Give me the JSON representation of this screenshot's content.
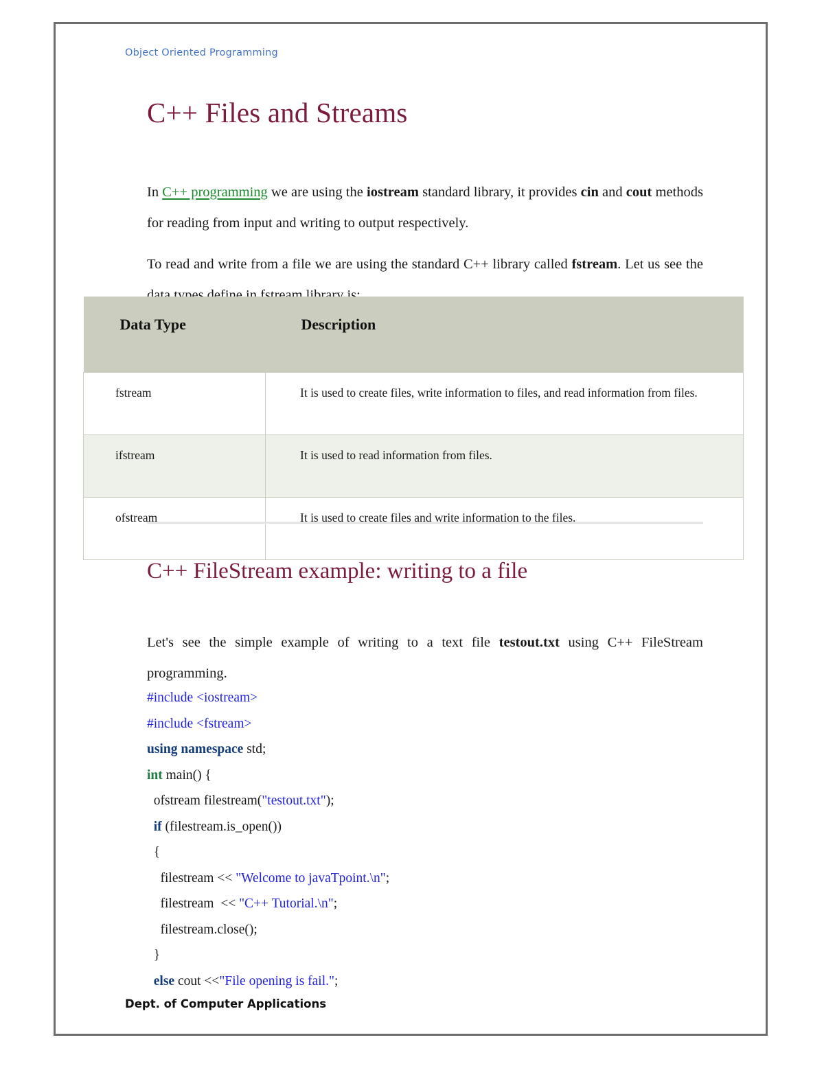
{
  "document": {
    "running_header": "Object Oriented Programming",
    "footer": "Dept. of Computer Applications",
    "title": "C++ Files and Streams",
    "subtitle": "C++ FileStream example: writing to a file"
  },
  "colors": {
    "heading": "#7b1b3e",
    "header_blue": "#4472c4",
    "link_green": "#1c8a2e",
    "table_header_bg": "#cbceBF",
    "table_alt_row_bg": "#eef1ea",
    "table_border": "#c9cdbd",
    "page_border": "#6e6c6c",
    "code_string": "#2222dd",
    "code_keyword": "#123c7a",
    "code_type": "#1f7a3d"
  },
  "paragraphs": {
    "intro": {
      "before_link": "In ",
      "link_text": "C++ programming",
      "after_link": " we are using the ",
      "bold_1": "iostream",
      "mid_1": " standard library, it provides ",
      "bold_2": "cin",
      "mid_2": " and ",
      "bold_3": "cout",
      "tail": " methods for reading from input and writing to output respectively."
    },
    "fstream_intro": {
      "head": "To read and write from a file we are using the standard C++ library called ",
      "bold_1": "fstream",
      "tail": ". Let us see the data types define in fstream library is:"
    },
    "example_intro": {
      "head": "Let's see the simple example of writing to a text file ",
      "bold_1": "testout.txt",
      "tail": " using C++ FileStream programming."
    }
  },
  "table": {
    "columns": [
      "Data Type",
      "Description"
    ],
    "rows": [
      {
        "data_type": "fstream",
        "description": "It is used to create files, write information to files, and read information from files."
      },
      {
        "data_type": "ifstream",
        "description": "It is used to read information from files."
      },
      {
        "data_type": "ofstream",
        "description": "It is used to create files and write information to the files."
      }
    ]
  },
  "code": {
    "lines": [
      {
        "tokens": [
          {
            "t": "#include <iostream>",
            "c": "kw-blue"
          }
        ]
      },
      {
        "tokens": [
          {
            "t": "#include <fstream>",
            "c": "kw-blue"
          }
        ]
      },
      {
        "tokens": [
          {
            "t": "using namespace",
            "c": "kw-navy"
          },
          {
            "t": " std;",
            "c": "punct"
          }
        ]
      },
      {
        "tokens": [
          {
            "t": "int",
            "c": "kw-green"
          },
          {
            "t": " main() {",
            "c": "punct"
          }
        ]
      },
      {
        "tokens": [
          {
            "t": "  ofstream filestream(",
            "c": "punct"
          },
          {
            "t": "\"testout.txt\"",
            "c": "str"
          },
          {
            "t": ");",
            "c": "punct"
          }
        ]
      },
      {
        "tokens": [
          {
            "t": "  ",
            "c": "punct"
          },
          {
            "t": "if",
            "c": "kw-if"
          },
          {
            "t": " (filestream.is_open())",
            "c": "punct"
          }
        ]
      },
      {
        "tokens": [
          {
            "t": "  {",
            "c": "punct"
          }
        ]
      },
      {
        "tokens": [
          {
            "t": "    filestream << ",
            "c": "punct"
          },
          {
            "t": "\"Welcome to javaTpoint.\\n\"",
            "c": "str"
          },
          {
            "t": ";",
            "c": "punct"
          }
        ]
      },
      {
        "tokens": [
          {
            "t": "    filestream  << ",
            "c": "punct"
          },
          {
            "t": "\"C++ Tutorial.\\n\"",
            "c": "str"
          },
          {
            "t": ";",
            "c": "punct"
          }
        ]
      },
      {
        "tokens": [
          {
            "t": "    filestream.close();",
            "c": "punct"
          }
        ]
      },
      {
        "tokens": [
          {
            "t": "  }",
            "c": "punct"
          }
        ]
      },
      {
        "tokens": [
          {
            "t": "  ",
            "c": "punct"
          },
          {
            "t": "else",
            "c": "kw-if"
          },
          {
            "t": " cout <<",
            "c": "punct"
          },
          {
            "t": "\"File opening is fail.\"",
            "c": "str"
          },
          {
            "t": ";",
            "c": "punct"
          }
        ]
      }
    ]
  }
}
